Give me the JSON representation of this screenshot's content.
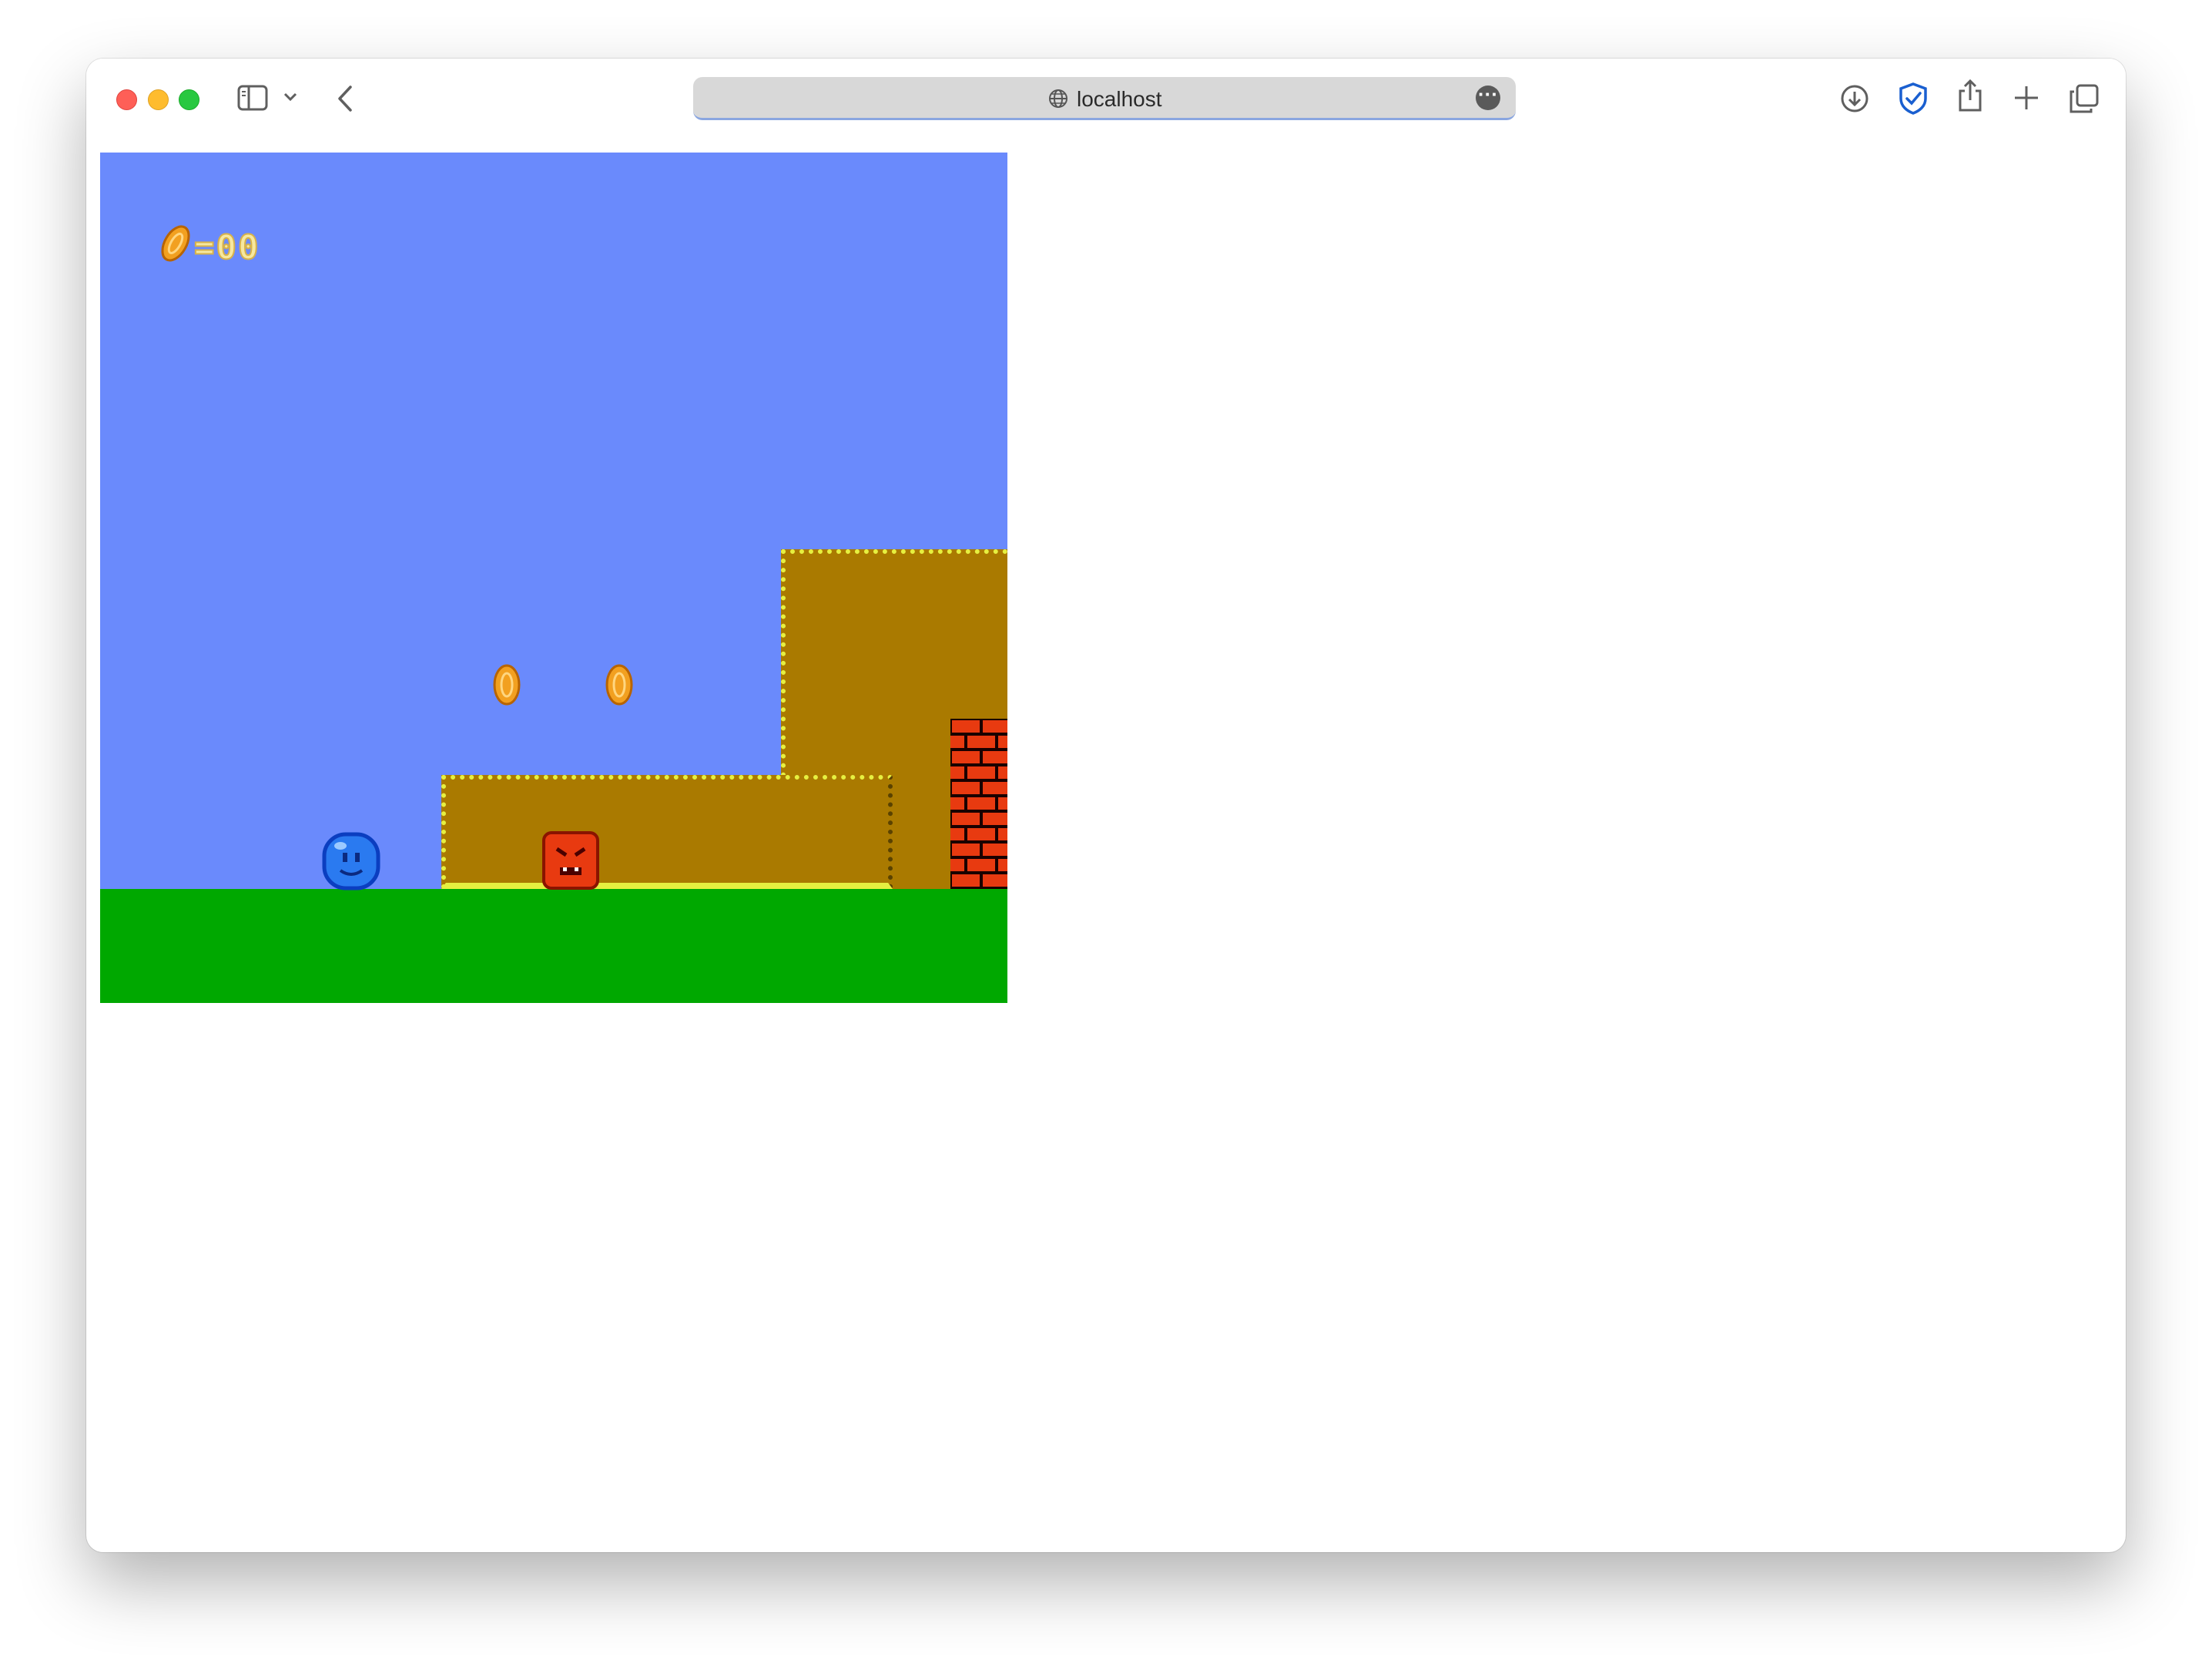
{
  "browser": {
    "address": "localhost",
    "more_glyph": "···"
  },
  "icons": {
    "sidebar": "sidebar-icon",
    "chevron": "chevron-down-icon",
    "back": "back-arrow-icon",
    "globe": "globe-icon",
    "download": "download-icon",
    "shield": "shield-check-icon",
    "share": "share-icon",
    "new_tab": "plus-icon",
    "tabs": "tabs-overview-icon"
  },
  "game": {
    "hud": {
      "coin_count_text": "=00"
    },
    "colors": {
      "sky": "#6a8afc",
      "ground": "#00a800",
      "dirt": "#aa7a00",
      "dirt_edge": "#e6f040",
      "brick": "#e83a10",
      "coin": "#f2a020",
      "player": "#2a7af0",
      "enemy": "#e83a10"
    }
  }
}
